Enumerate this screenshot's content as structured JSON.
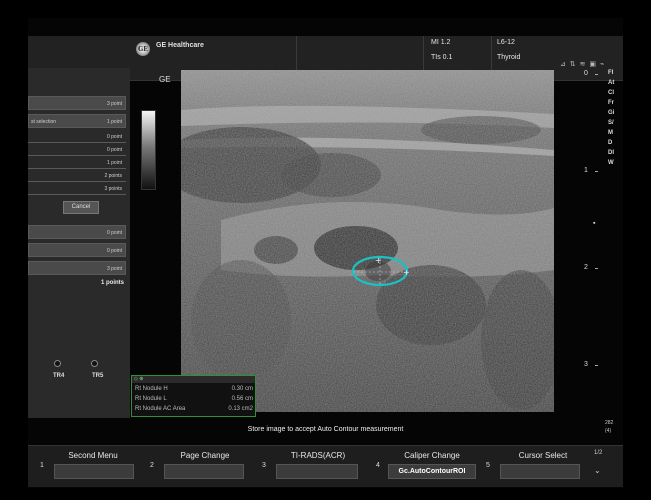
{
  "header": {
    "brand": "GE Healthcare",
    "mi": "MI 1.2",
    "tis": "TIs 0.1",
    "probe": "L6-12",
    "preset": "Thyroid",
    "icons_text": "⊿ ⇅ ≋ ▣ ⌁"
  },
  "left_panel": {
    "title": ")",
    "rows_top": [
      {
        "label": "",
        "value": "3 point"
      },
      {
        "label": "st selection",
        "value": "1 point"
      }
    ],
    "lines": [
      "0 point",
      "0 point",
      "1 point",
      "2 points",
      "3 points"
    ],
    "cancel_label": "Cancel",
    "rows_bottom": [
      "0 point",
      "0 point",
      "3 point"
    ],
    "total": "1 points",
    "tr_labels": [
      "TR4",
      "TR5"
    ]
  },
  "image": {
    "ge_mark": "GE"
  },
  "measurement": {
    "header_icons": "◇ ⊕",
    "rows": [
      {
        "label": "Rt  Nodule H",
        "value": "0.30 cm"
      },
      {
        "label": "Rt  Nodule L",
        "value": "0.56 cm"
      },
      {
        "label": "Rt  Nodule AC Area",
        "value": "0.13 cm2"
      }
    ]
  },
  "status": "Store image to accept Auto Contour measurement",
  "depth_scale": [
    "0",
    "1",
    "2",
    "3"
  ],
  "right_info": "FI\nAt\nCl\nFr\nGi\nS/\nM\nD\nDI\nW",
  "right_side_bottom": [
    "282",
    "(4)",
    ""
  ],
  "focus_mark": "▪",
  "softkeys": [
    {
      "num": "1",
      "title": "Second Menu",
      "value": ""
    },
    {
      "num": "2",
      "title": "Page Change",
      "value": ""
    },
    {
      "num": "3",
      "title": "TI-RADS(ACR)",
      "value": ""
    },
    {
      "num": "4",
      "title": "Caliper Change",
      "value": "Gc.AutoContourROI"
    },
    {
      "num": "5",
      "title": "Cursor Select",
      "value": ""
    }
  ],
  "page_indicator": "1/2",
  "chevron": "⌄",
  "colors": {
    "contour": "#19c2c2",
    "measure_border": "#2f8f3a"
  }
}
